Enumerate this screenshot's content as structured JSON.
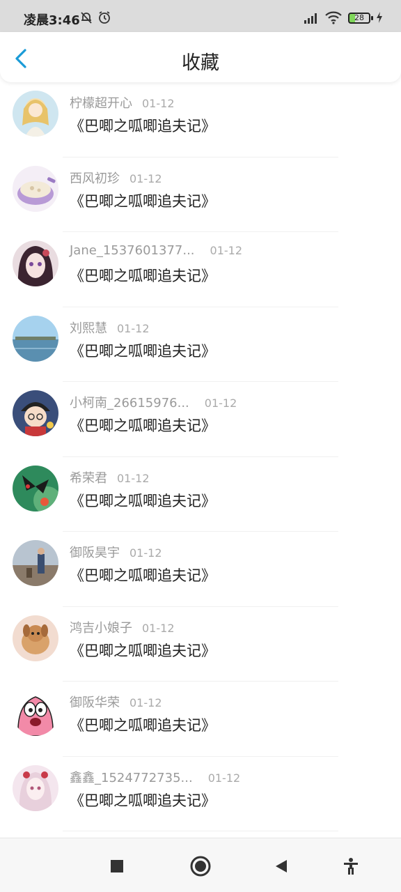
{
  "status_bar": {
    "time": "凌晨3:46",
    "battery": "28"
  },
  "header": {
    "title": "收藏"
  },
  "items": [
    {
      "name": "柠檬超开心",
      "date": "01-12",
      "title": "《巴唧之呱唧追夫记》",
      "avatar_color": "#f2d89a"
    },
    {
      "name": "西风初珍",
      "date": "01-12",
      "title": "《巴唧之呱唧追夫记》",
      "avatar_color": "#d9c8ea"
    },
    {
      "name": "Jane_1537601377...",
      "date": "01-12",
      "title": "《巴唧之呱唧追夫记》",
      "avatar_color": "#6b4a4a"
    },
    {
      "name": "刘熙慧",
      "date": "01-12",
      "title": "《巴唧之呱唧追夫记》",
      "avatar_color": "#7fb6d8"
    },
    {
      "name": "小柯南_26615976...",
      "date": "01-12",
      "title": "《巴唧之呱唧追夫记》",
      "avatar_color": "#3a4e7a"
    },
    {
      "name": "希荣君",
      "date": "01-12",
      "title": "《巴唧之呱唧追夫记》",
      "avatar_color": "#3a9a6a"
    },
    {
      "name": "御阪昊宇",
      "date": "01-12",
      "title": "《巴唧之呱唧追夫记》",
      "avatar_color": "#8a9aa8"
    },
    {
      "name": "鸿吉小娘子",
      "date": "01-12",
      "title": "《巴唧之呱唧追夫记》",
      "avatar_color": "#d9a26a"
    },
    {
      "name": "御阪华荣",
      "date": "01-12",
      "title": "《巴唧之呱唧追夫记》",
      "avatar_color": "#f08aa8"
    },
    {
      "name": "鑫鑫_1524772735...",
      "date": "01-12",
      "title": "《巴唧之呱唧追夫记》",
      "avatar_color": "#e8c8d8"
    }
  ],
  "nav_bar": {
    "icons": [
      "square-recent-icon",
      "circle-home-icon",
      "triangle-back-icon",
      "accessibility-icon"
    ]
  },
  "colors": {
    "accent": "#1a9bd7",
    "status_bar_bg": "#dcdcdc",
    "text_primary": "#222222",
    "text_secondary": "#9a9a9a"
  }
}
